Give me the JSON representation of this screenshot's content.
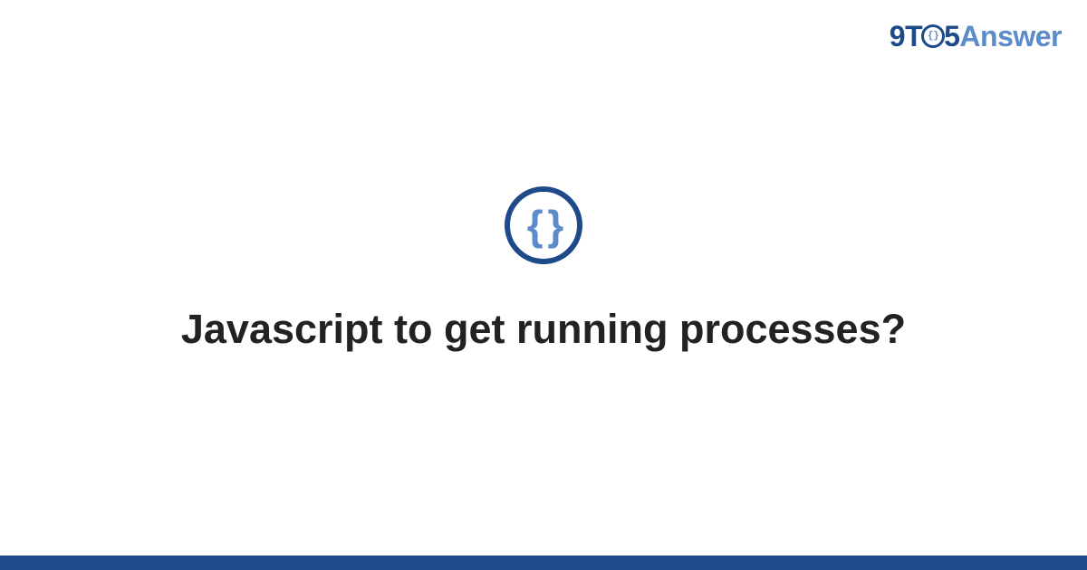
{
  "logo": {
    "part1": "9T",
    "o_inner": "{}",
    "part2": "5",
    "part3": "Answer"
  },
  "icon": {
    "name": "code-braces-icon",
    "glyph": "{ }"
  },
  "title": "Javascript to get running processes?",
  "colors": {
    "primary": "#1e4a8a",
    "accent": "#5b8bc9"
  }
}
